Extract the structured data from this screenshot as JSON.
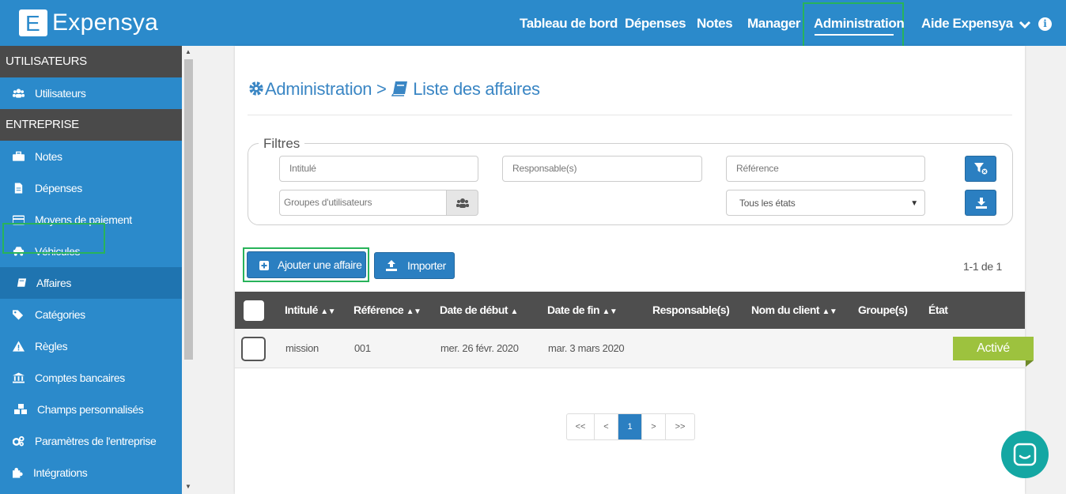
{
  "app": {
    "logo_letter": "E",
    "logo_name": "Expensya"
  },
  "nav": {
    "items": [
      {
        "label": "Tableau de bord"
      },
      {
        "label": "Dépenses"
      },
      {
        "label": "Notes"
      },
      {
        "label": "Manager"
      },
      {
        "label": "Administration",
        "active": true
      },
      {
        "label": "Aide Expensya"
      }
    ],
    "info_icon": "info-icon"
  },
  "sidebar": {
    "section_users": "UTILISATEURS",
    "section_company": "ENTREPRISE",
    "items": [
      {
        "label": "Utilisateurs",
        "icon": "users-icon"
      },
      {
        "label": "Notes",
        "icon": "briefcase-icon"
      },
      {
        "label": "Dépenses",
        "icon": "file-icon"
      },
      {
        "label": "Moyens de paiement",
        "icon": "credit-card-icon"
      },
      {
        "label": "Véhicules",
        "icon": "car-icon"
      },
      {
        "label": "Affaires",
        "icon": "book-icon",
        "active": true
      },
      {
        "label": "Catégories",
        "icon": "tags-icon"
      },
      {
        "label": "Règles",
        "icon": "warning-icon"
      },
      {
        "label": "Comptes bancaires",
        "icon": "bank-icon"
      },
      {
        "label": "Champs personnalisés",
        "icon": "cubes-icon"
      },
      {
        "label": "Paramètres de l'entreprise",
        "icon": "cogs-icon"
      },
      {
        "label": "Intégrations",
        "icon": "puzzle-icon"
      }
    ]
  },
  "page": {
    "breadcrumb_root": "Administration",
    "breadcrumb_sep": ">",
    "breadcrumb_current": "Liste des affaires"
  },
  "filters": {
    "legend": "Filtres",
    "intitule_placeholder": "Intitulé",
    "responsable_placeholder": "Responsable(s)",
    "reference_placeholder": "Référence",
    "groups_placeholder": "Groupes d'utilisateurs",
    "state_selected": "Tous les états"
  },
  "actions": {
    "add_label": "Ajouter une affaire",
    "import_label": "Importer",
    "count": "1-1 de 1"
  },
  "table": {
    "columns": [
      "Intitulé",
      "Référence",
      "Date de début",
      "Date de fin",
      "Responsable(s)",
      "Nom du client",
      "Groupe(s)",
      "État"
    ],
    "rows": [
      {
        "intitule": "mission",
        "reference": "001",
        "date_debut": "mer. 26 févr. 2020",
        "date_fin": "mar. 3 mars 2020",
        "etat": "Activé"
      }
    ]
  },
  "pagination": {
    "first": "<<",
    "prev": "<",
    "current": "1",
    "next": ">",
    "last": ">>"
  },
  "colors": {
    "primary": "#2b8acb",
    "button": "#2b7fc1",
    "highlight": "#28b35a",
    "active_badge": "#9dc23e",
    "chat": "#14a7a3"
  }
}
